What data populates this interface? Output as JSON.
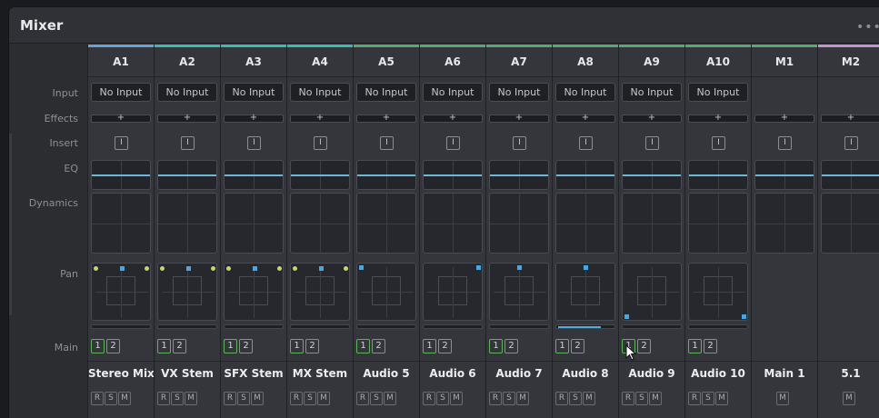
{
  "window": {
    "title": "Mixer",
    "menu_label": "•••"
  },
  "row_labels": {
    "input": "Input",
    "effects": "Effects",
    "insert": "Insert",
    "eq": "EQ",
    "dynamics": "Dynamics",
    "pan": "Pan",
    "main": "Main"
  },
  "colors": {
    "teal": "#3db8b3",
    "green": "#59a86e",
    "blue": "#6aa2d8",
    "pink": "#c98fd4"
  },
  "channels": [
    {
      "id": "A1",
      "color": "#6aa2d8",
      "input": "No Input",
      "effects": "+",
      "insert": "I",
      "track": "Stereo Mix",
      "main": [
        "1",
        "2"
      ],
      "buttons": [
        "R",
        "S",
        "M"
      ],
      "pan": "stereo"
    },
    {
      "id": "A2",
      "color": "#3db8b3",
      "input": "No Input",
      "effects": "+",
      "insert": "I",
      "track": "VX Stem",
      "main": [
        "1",
        "2"
      ],
      "buttons": [
        "R",
        "S",
        "M"
      ],
      "pan": "stereo"
    },
    {
      "id": "A3",
      "color": "#3db8b3",
      "input": "No Input",
      "effects": "+",
      "insert": "I",
      "track": "SFX Stem",
      "main": [
        "1",
        "2"
      ],
      "buttons": [
        "R",
        "S",
        "M"
      ],
      "pan": "stereo"
    },
    {
      "id": "A4",
      "color": "#3db8b3",
      "input": "No Input",
      "effects": "+",
      "insert": "I",
      "track": "MX Stem",
      "main": [
        "1",
        "2"
      ],
      "buttons": [
        "R",
        "S",
        "M"
      ],
      "pan": "stereo"
    },
    {
      "id": "A5",
      "color": "#59a86e",
      "input": "No Input",
      "effects": "+",
      "insert": "I",
      "track": "Audio 5",
      "main": [
        "1",
        "2"
      ],
      "buttons": [
        "R",
        "S",
        "M"
      ],
      "pan": "topleft"
    },
    {
      "id": "A6",
      "color": "#59a86e",
      "input": "No Input",
      "effects": "+",
      "insert": "I",
      "track": "Audio 6",
      "main": [
        "1",
        "2"
      ],
      "buttons": [
        "R",
        "S",
        "M"
      ],
      "pan": "topright"
    },
    {
      "id": "A7",
      "color": "#59a86e",
      "input": "No Input",
      "effects": "+",
      "insert": "I",
      "track": "Audio 7",
      "main": [
        "1",
        "2"
      ],
      "buttons": [
        "R",
        "S",
        "M"
      ],
      "pan": "topcenter"
    },
    {
      "id": "A8",
      "color": "#59a86e",
      "input": "No Input",
      "effects": "+",
      "insert": "I",
      "track": "Audio 8",
      "main": [
        "1",
        "2"
      ],
      "buttons": [
        "R",
        "S",
        "M"
      ],
      "pan": "topcenter",
      "level": 0.75
    },
    {
      "id": "A9",
      "color": "#59a86e",
      "input": "No Input",
      "effects": "+",
      "insert": "I",
      "track": "Audio 9",
      "main": [
        "1",
        "2"
      ],
      "buttons": [
        "R",
        "S",
        "M"
      ],
      "pan": "bottomleft"
    },
    {
      "id": "A10",
      "color": "#59a86e",
      "input": "No Input",
      "effects": "+",
      "insert": "I",
      "track": "Audio 10",
      "main": [
        "1",
        "2"
      ],
      "buttons": [
        "R",
        "S",
        "M"
      ],
      "pan": "bottomright"
    },
    {
      "id": "M1",
      "color": "#59a86e",
      "input": "",
      "effects": "+",
      "insert": "I",
      "track": "Main 1",
      "main": [],
      "buttons": [
        "M"
      ],
      "pan": "none"
    },
    {
      "id": "M2",
      "color": "#c98fd4",
      "input": "",
      "effects": "+",
      "insert": "I",
      "track": "5.1",
      "main": [],
      "buttons": [
        "M"
      ],
      "pan": "none"
    }
  ]
}
